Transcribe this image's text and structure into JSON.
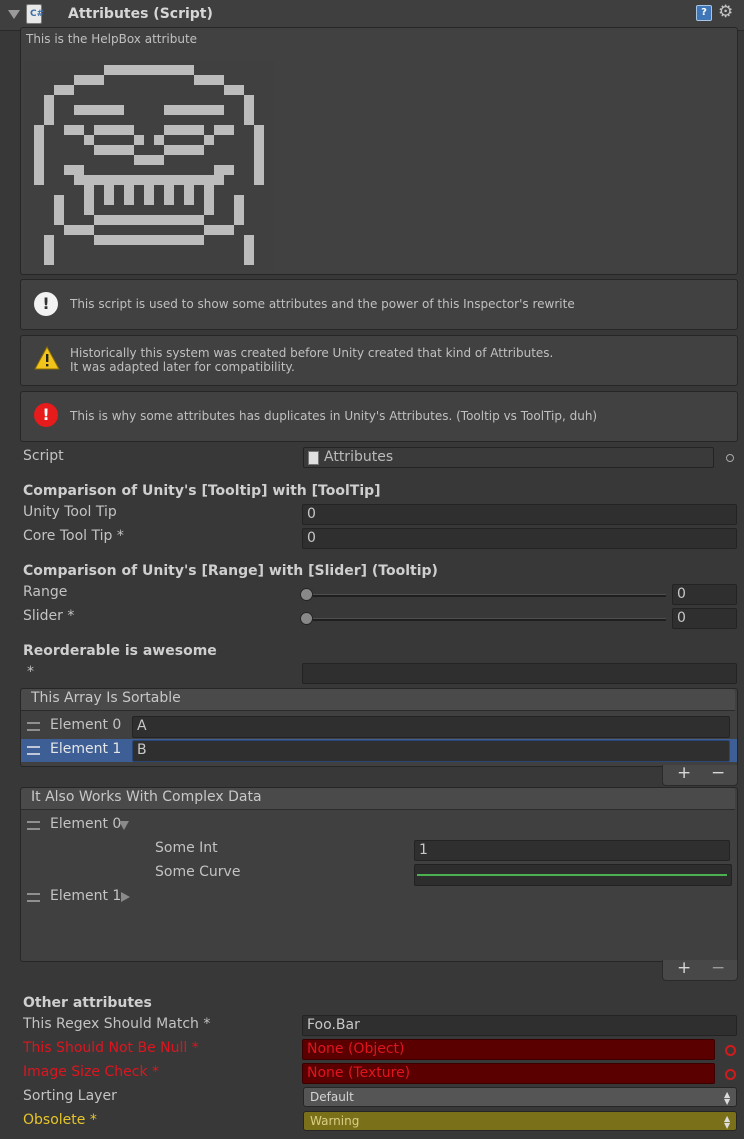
{
  "header": {
    "title": "Attributes (Script)",
    "help_icon": "?",
    "gear_icon": "gear-icon"
  },
  "helpbox_attribute": {
    "text": "This is the HelpBox attribute",
    "image": "pixel-art-face-image"
  },
  "messages": {
    "info": "This script is used to show some attributes and the power of this Inspector's rewrite",
    "warning_line1": "Historically this system was created before Unity created that kind of Attributes.",
    "warning_line2": "It was adapted later for compatibility.",
    "error": "This is why some attributes has duplicates in Unity's Attributes. (Tooltip vs ToolTip, duh)"
  },
  "script": {
    "label": "Script",
    "value": "Attributes"
  },
  "tooltip_section": {
    "title": "Comparison of Unity's [Tooltip] with [ToolTip]",
    "unity_label": "Unity Tool Tip",
    "unity_value": "0",
    "core_label": "Core Tool Tip *",
    "core_value": "0"
  },
  "range_section": {
    "title": "Comparison of Unity's [Range] with [Slider] (Tooltip)",
    "range_label": "Range",
    "range_value": "0",
    "slider_label": "Slider *",
    "slider_value": "0"
  },
  "reorderable": {
    "title": "Reorderable is awesome",
    "star_label": "*",
    "star_value": ""
  },
  "sortable_list": {
    "header": "This Array Is Sortable",
    "elements": [
      {
        "label": "Element 0",
        "value": "A"
      },
      {
        "label": "Element 1",
        "value": "B"
      }
    ],
    "add": "+",
    "remove": "−"
  },
  "complex_list": {
    "header": "It Also Works With Complex Data",
    "element0": "Element 0",
    "some_int_label": "Some Int",
    "some_int_value": "1",
    "some_curve_label": "Some Curve",
    "element1": "Element 1",
    "add": "+",
    "remove": "−",
    "curve_color": "#4caf50"
  },
  "other": {
    "title": "Other attributes",
    "regex_label": "This Regex Should Match *",
    "regex_value": "Foo.Bar",
    "notnull_label": "This Should Not Be Null *",
    "notnull_value": "None (Object)",
    "imagesize_label": "Image Size Check *",
    "imagesize_value": "None (Texture)",
    "sorting_label": "Sorting Layer",
    "sorting_value": "Default",
    "obsolete_label": "Obsolete *",
    "obsolete_value": "Warning"
  },
  "colors": {
    "background": "#383838",
    "error_red": "#e0141e",
    "warning_yellow": "#e6c52b",
    "selection_blue": "#3e5f96"
  }
}
